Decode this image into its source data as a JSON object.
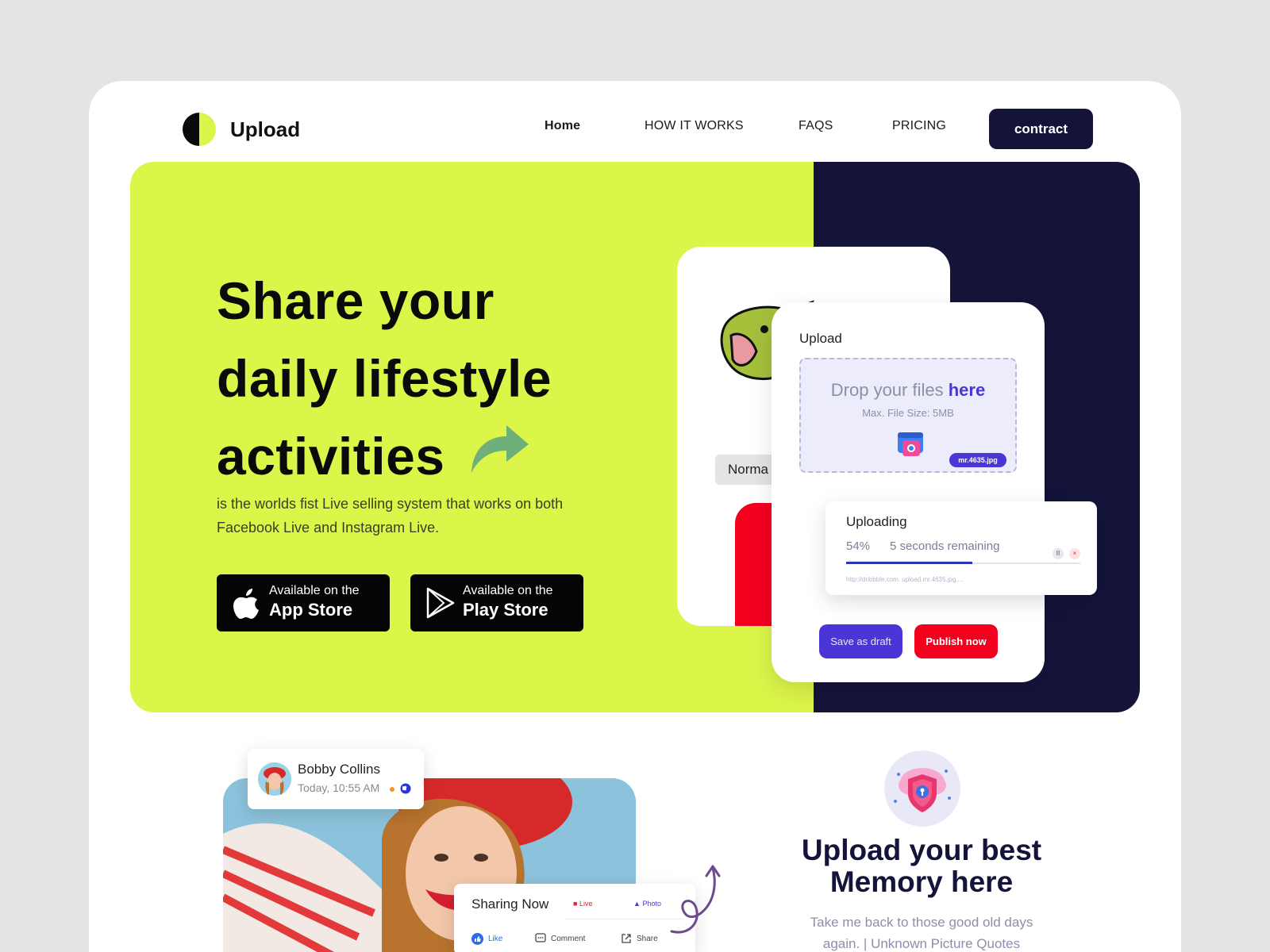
{
  "brand": {
    "name": "Upload",
    "colors": {
      "lime": "#dcf549",
      "navy": "#14143b",
      "violet": "#4a36d6",
      "red": "#f3001f"
    }
  },
  "nav": {
    "items": [
      "Home",
      "HOW IT WORKS",
      "FAQS",
      "PRICING"
    ],
    "cta": "contract"
  },
  "hero": {
    "headline_lines": [
      "Share your",
      "daily lifestyle",
      "activities"
    ],
    "subtext": "is the worlds fist Live selling system that works on both Facebook Live and Instagram Live.",
    "app_store": {
      "small": "Available on the",
      "big": "App Store",
      "icon": "apple-icon"
    },
    "play_store": {
      "small": "Available on the",
      "big": "Play Store",
      "icon": "play-icon"
    }
  },
  "mock": {
    "back_chip": "Norma",
    "upload_title": "Upload",
    "drop_text": "Drop your files",
    "drop_highlight": "here",
    "max_size": "Max. File Size: 5MB",
    "file_badge": "mr.4635.jpg",
    "save_draft": "Save as draft",
    "publish": "Publish now",
    "uploading": {
      "title": "Uploading",
      "percent": "54%",
      "progress": 0.54,
      "remaining": "5 seconds remaining",
      "url": "http://dribbble.com. upload.mr.4635.jpg...."
    }
  },
  "post": {
    "name": "Bobby Collins",
    "time": "Today, 10:55 AM",
    "sharing_title": "Sharing Now",
    "live": "Live",
    "photo": "Photo",
    "like": "Like",
    "comment": "Comment",
    "share": "Share"
  },
  "memory": {
    "title_line1": "Upload your best",
    "title_line2": "Memory here",
    "sub_line1": "Take me back to those good old days",
    "sub_line2": "again. | Unknown Picture Quotes"
  }
}
